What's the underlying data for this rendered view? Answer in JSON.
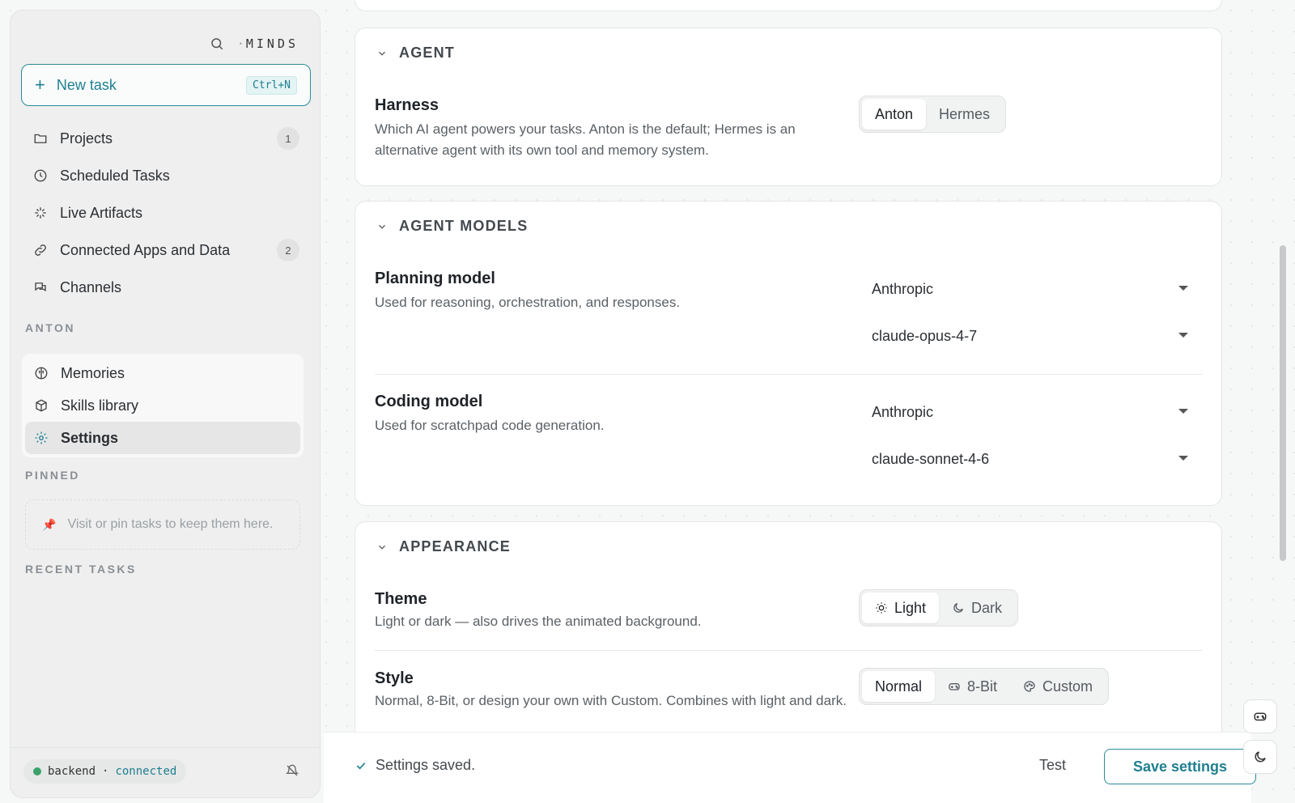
{
  "brand": {
    "prefix": "·",
    "name": "MINDS"
  },
  "sidebar": {
    "new_task": {
      "label": "New task",
      "shortcut": "Ctrl+N"
    },
    "nav": [
      {
        "label": "Projects",
        "count": "1",
        "icon": "folder-icon"
      },
      {
        "label": "Scheduled Tasks",
        "icon": "clock-icon"
      },
      {
        "label": "Live Artifacts",
        "icon": "sparkle-icon"
      },
      {
        "label": "Connected Apps and Data",
        "count": "2",
        "icon": "link-icon"
      },
      {
        "label": "Channels",
        "icon": "chat-icon"
      }
    ],
    "anton_label": "ANTON",
    "anton_items": [
      {
        "label": "Memories",
        "icon": "brain-icon"
      },
      {
        "label": "Skills library",
        "icon": "cube-icon"
      },
      {
        "label": "Settings",
        "icon": "gear-icon",
        "active": true
      }
    ],
    "pinned_label": "PINNED",
    "pinned_placeholder": "Visit or pin tasks to keep them here.",
    "recent_label": "RECENT TASKS",
    "status": {
      "service": "backend",
      "separator": "·",
      "state": "connected"
    }
  },
  "agent_section": {
    "heading": "AGENT",
    "harness": {
      "title": "Harness",
      "description": "Which AI agent powers your tasks. Anton is the default; Hermes is an alternative agent with its own tool and memory system.",
      "options": [
        "Anton",
        "Hermes"
      ],
      "selected": "Anton"
    }
  },
  "models_section": {
    "heading": "AGENT MODELS",
    "planning": {
      "title": "Planning model",
      "description": "Used for reasoning, orchestration, and responses.",
      "provider": "Anthropic",
      "model": "claude-opus-4-7"
    },
    "coding": {
      "title": "Coding model",
      "description": "Used for scratchpad code generation.",
      "provider": "Anthropic",
      "model": "claude-sonnet-4-6"
    }
  },
  "appearance_section": {
    "heading": "APPEARANCE",
    "theme": {
      "title": "Theme",
      "description": "Light or dark — also drives the animated background.",
      "options": [
        "Light",
        "Dark"
      ],
      "selected": "Light"
    },
    "style": {
      "title": "Style",
      "description": "Normal, 8-Bit, or design your own with Custom. Combines with light and dark.",
      "options": [
        "Normal",
        "8-Bit",
        "Custom"
      ],
      "selected": "Normal"
    }
  },
  "footer": {
    "saved_text": "Settings saved.",
    "test_label": "Test",
    "save_label": "Save settings"
  },
  "colors": {
    "accent": "#1e7f8f",
    "status_ok": "#3aa26a"
  }
}
